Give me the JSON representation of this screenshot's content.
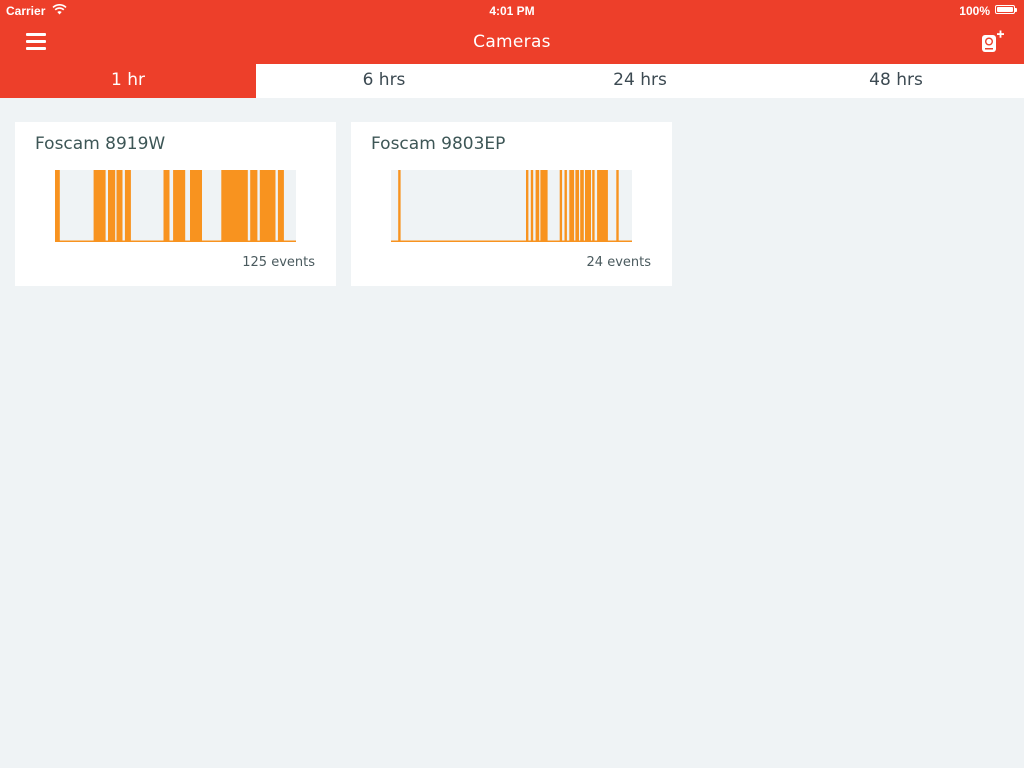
{
  "status_bar": {
    "carrier": "Carrier",
    "time": "4:01 PM",
    "battery": "100%"
  },
  "nav": {
    "title": "Cameras",
    "menu_icon": "hamburger-menu-icon",
    "add_icon": "add-camera-icon"
  },
  "tabs": [
    {
      "label": "1 hr",
      "active": true
    },
    {
      "label": "6 hrs",
      "active": false
    },
    {
      "label": "24 hrs",
      "active": false
    },
    {
      "label": "48 hrs",
      "active": false
    }
  ],
  "colors": {
    "accent": "#ed3f2a",
    "event_bar": "#f8931f",
    "chart_bg": "#eff3f5",
    "page_bg": "#eff3f5"
  },
  "cameras": [
    {
      "name": "Foscam 8919W",
      "events_label": "125 events",
      "activity": {
        "window": "1 hr",
        "segments": [
          [
            0.0,
            0.02
          ],
          [
            0.16,
            0.21
          ],
          [
            0.22,
            0.25
          ],
          [
            0.255,
            0.28
          ],
          [
            0.29,
            0.315
          ],
          [
            0.45,
            0.475
          ],
          [
            0.49,
            0.54
          ],
          [
            0.56,
            0.61
          ],
          [
            0.69,
            0.8
          ],
          [
            0.81,
            0.84
          ],
          [
            0.85,
            0.915
          ],
          [
            0.925,
            0.95
          ]
        ]
      }
    },
    {
      "name": "Foscam 9803EP",
      "events_label": "24 events",
      "activity": {
        "window": "1 hr",
        "segments": [
          [
            0.03,
            0.04
          ],
          [
            0.56,
            0.57
          ],
          [
            0.58,
            0.59
          ],
          [
            0.6,
            0.615
          ],
          [
            0.62,
            0.65
          ],
          [
            0.7,
            0.71
          ],
          [
            0.72,
            0.73
          ],
          [
            0.74,
            0.76
          ],
          [
            0.765,
            0.78
          ],
          [
            0.785,
            0.8
          ],
          [
            0.805,
            0.83
          ],
          [
            0.835,
            0.845
          ],
          [
            0.855,
            0.9
          ],
          [
            0.935,
            0.945
          ]
        ]
      }
    }
  ]
}
